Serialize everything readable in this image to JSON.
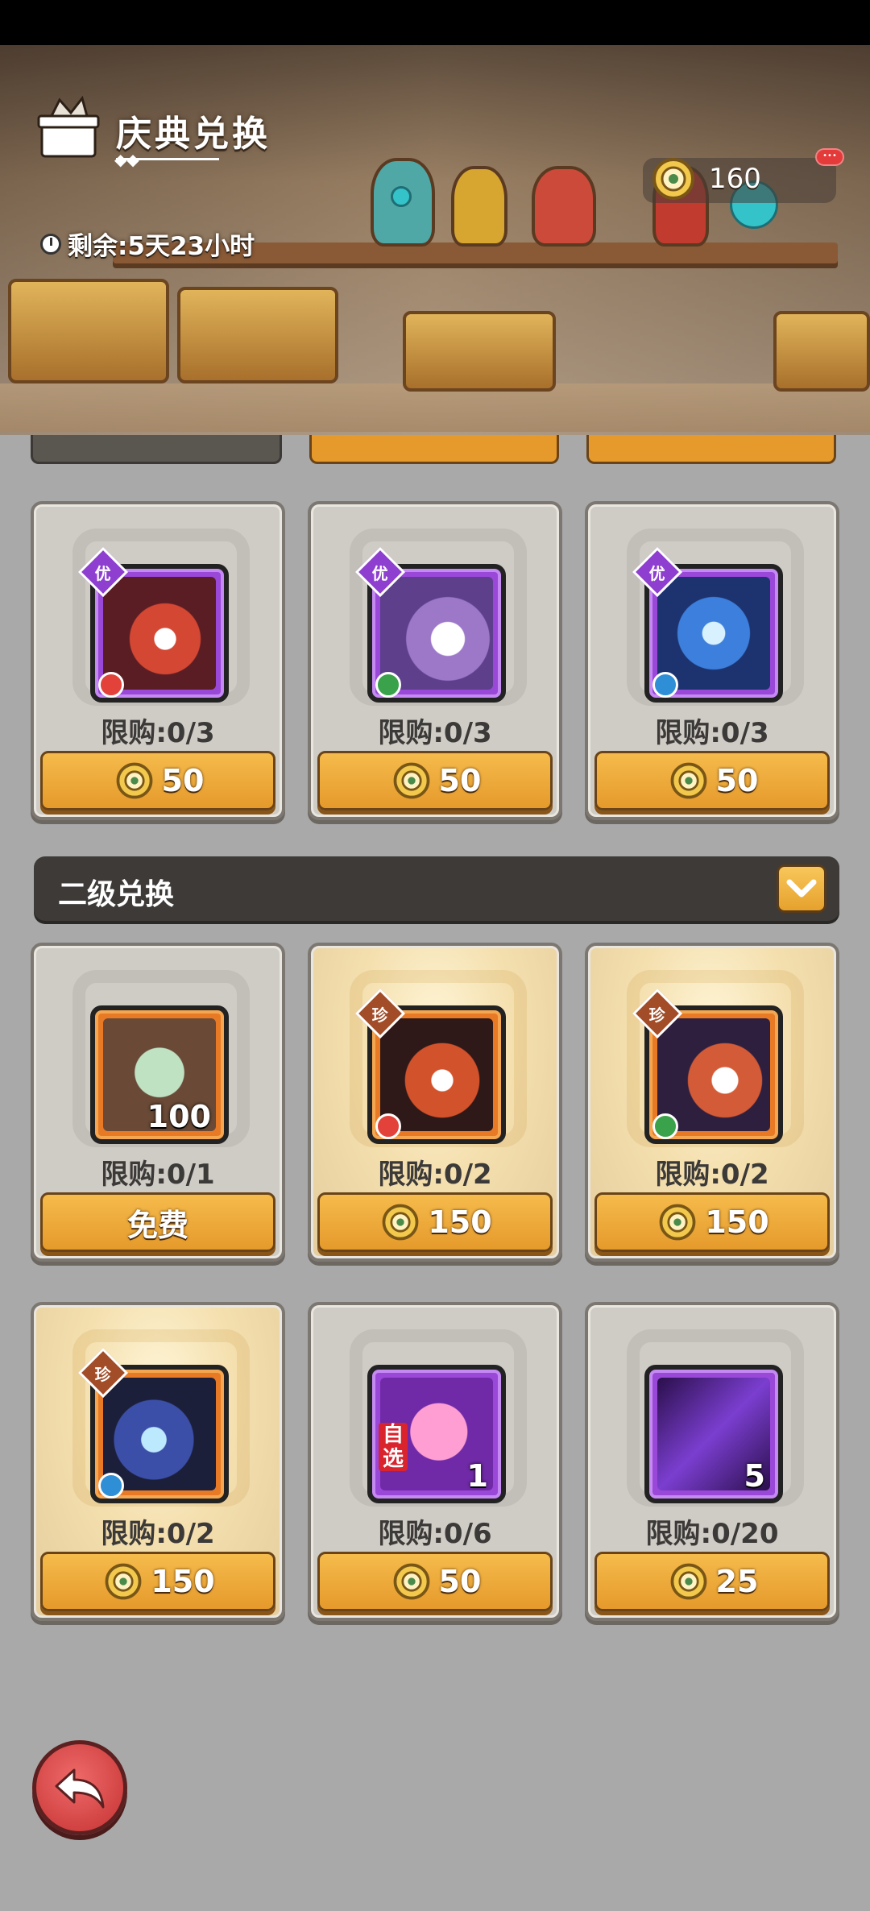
{
  "header": {
    "title": "庆典兑换",
    "timer_text": "剩余:5天23小时",
    "currency_value": "160"
  },
  "section1": {
    "items": [
      {
        "limit": "限购:0/3",
        "price": "50",
        "rank": "优"
      },
      {
        "limit": "限购:0/3",
        "price": "50",
        "rank": "优"
      },
      {
        "limit": "限购:0/3",
        "price": "50",
        "rank": "优"
      }
    ]
  },
  "section2": {
    "title": "二级兑换",
    "row1": [
      {
        "limit": "限购:0/1",
        "button_label": "免费",
        "quantity": "100"
      },
      {
        "limit": "限购:0/2",
        "price": "150",
        "rank": "珍"
      },
      {
        "limit": "限购:0/2",
        "price": "150",
        "rank": "珍"
      }
    ],
    "row2": [
      {
        "limit": "限购:0/2",
        "price": "150",
        "rank": "珍"
      },
      {
        "limit": "限购:0/6",
        "price": "50",
        "quantity": "1",
        "tag": "自选"
      },
      {
        "limit": "限购:0/20",
        "price": "25",
        "quantity": "5"
      }
    ]
  },
  "icons": {
    "coin": "festival-coin-icon",
    "back": "back-arrow-icon",
    "collapse": "chevron-down-icon"
  },
  "colors": {
    "button": "#e59a2b",
    "section_bar": "#3d3a38",
    "back_button": "#c53232"
  }
}
